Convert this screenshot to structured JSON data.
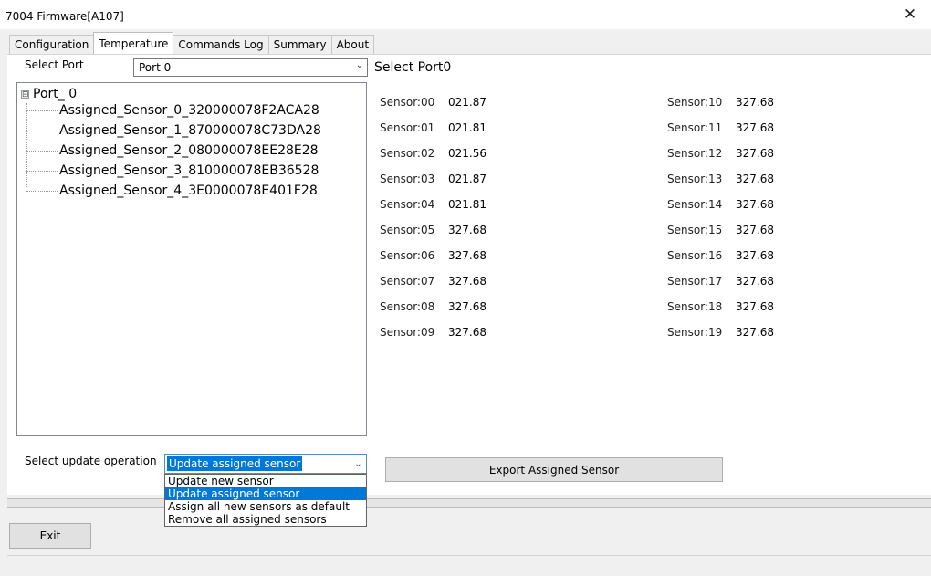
{
  "window": {
    "title": "7004 Firmware[A107]",
    "close_glyph": "✕"
  },
  "tabs": [
    {
      "label": "Configuration",
      "active": false
    },
    {
      "label": "Temperature",
      "active": true
    },
    {
      "label": "Commands Log",
      "active": false
    },
    {
      "label": "Summary",
      "active": false
    },
    {
      "label": "About",
      "active": false
    }
  ],
  "port_select": {
    "label": "Select Port",
    "value": "Port 0"
  },
  "heading": "Select Port0",
  "tree": {
    "expander": "⊟",
    "root": "Port_ 0",
    "items": [
      "Assigned_Sensor_0_320000078F2ACA28",
      "Assigned_Sensor_1_870000078C73DA28",
      "Assigned_Sensor_2_080000078EE28E28",
      "Assigned_Sensor_3_810000078EB36528",
      "Assigned_Sensor_4_3E0000078E401F28"
    ]
  },
  "sensors_left": [
    {
      "label": "Sensor:00",
      "value": "021.87"
    },
    {
      "label": "Sensor:01",
      "value": "021.81"
    },
    {
      "label": "Sensor:02",
      "value": "021.56"
    },
    {
      "label": "Sensor:03",
      "value": "021.87"
    },
    {
      "label": "Sensor:04",
      "value": "021.81"
    },
    {
      "label": "Sensor:05",
      "value": "327.68"
    },
    {
      "label": "Sensor:06",
      "value": "327.68"
    },
    {
      "label": "Sensor:07",
      "value": "327.68"
    },
    {
      "label": "Sensor:08",
      "value": "327.68"
    },
    {
      "label": "Sensor:09",
      "value": "327.68"
    }
  ],
  "sensors_right": [
    {
      "label": "Sensor:10",
      "value": "327.68"
    },
    {
      "label": "Sensor:11",
      "value": "327.68"
    },
    {
      "label": "Sensor:12",
      "value": "327.68"
    },
    {
      "label": "Sensor:13",
      "value": "327.68"
    },
    {
      "label": "Sensor:14",
      "value": "327.68"
    },
    {
      "label": "Sensor:15",
      "value": "327.68"
    },
    {
      "label": "Sensor:16",
      "value": "327.68"
    },
    {
      "label": "Sensor:17",
      "value": "327.68"
    },
    {
      "label": "Sensor:18",
      "value": "327.68"
    },
    {
      "label": "Sensor:19",
      "value": "327.68"
    }
  ],
  "operation": {
    "label": "Select update operation",
    "value": "Update assigned sensor",
    "options": [
      "Update new sensor",
      "Update assigned sensor",
      "Assign all new sensors as default",
      "Remove all assigned sensors"
    ],
    "selected_index": 1
  },
  "buttons": {
    "export": "Export Assigned Sensor",
    "exit": "Exit"
  },
  "colors": {
    "selection": "#0078d7",
    "window_bg": "#f0f0f0"
  },
  "icons": {
    "dropdown": "chevron-down-icon",
    "close": "close-icon",
    "tree_expander": "minus-box-icon"
  }
}
